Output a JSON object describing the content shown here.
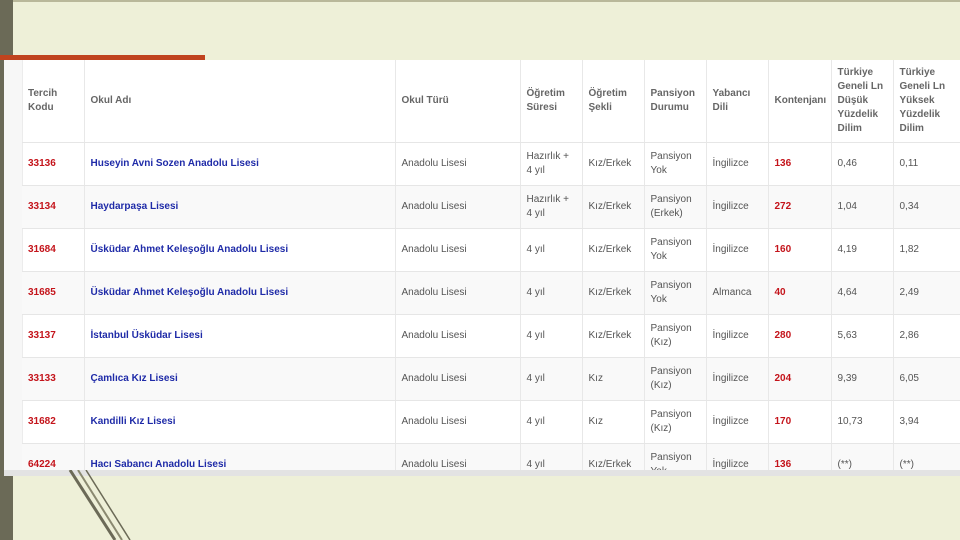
{
  "columns": [
    "Tercih Kodu",
    "Okul Adı",
    "Okul Türü",
    "Öğretim Süresi",
    "Öğretim Şekli",
    "Pansiyon Durumu",
    "Yabancı Dili",
    "Kontenjanı",
    "Türkiye Geneli Ln Düşük Yüzdelik Dilim",
    "Türkiye Geneli Ln Yüksek Yüzdelik Dilim"
  ],
  "rows": [
    {
      "code": "33136",
      "name": "Huseyin Avni Sozen Anadolu Lisesi",
      "type": "Anadolu Lisesi",
      "duration": "Hazırlık + 4 yıl",
      "mode": "Kız/Erkek",
      "boarding": "Pansiyon Yok",
      "language": "İngilizce",
      "quota": "136",
      "low": "0,46",
      "high": "0,11"
    },
    {
      "code": "33134",
      "name": "Haydarpaşa Lisesi",
      "type": "Anadolu Lisesi",
      "duration": "Hazırlık + 4 yıl",
      "mode": "Kız/Erkek",
      "boarding": "Pansiyon (Erkek)",
      "language": "İngilizce",
      "quota": "272",
      "low": "1,04",
      "high": "0,34"
    },
    {
      "code": "31684",
      "name": "Üsküdar Ahmet Keleşoğlu Anadolu Lisesi",
      "type": "Anadolu Lisesi",
      "duration": "4 yıl",
      "mode": "Kız/Erkek",
      "boarding": "Pansiyon Yok",
      "language": "İngilizce",
      "quota": "160",
      "low": "4,19",
      "high": "1,82"
    },
    {
      "code": "31685",
      "name": "Üsküdar Ahmet Keleşoğlu Anadolu Lisesi",
      "type": "Anadolu Lisesi",
      "duration": "4 yıl",
      "mode": "Kız/Erkek",
      "boarding": "Pansiyon Yok",
      "language": "Almanca",
      "quota": "40",
      "low": "4,64",
      "high": "2,49"
    },
    {
      "code": "33137",
      "name": "İstanbul Üsküdar Lisesi",
      "type": "Anadolu Lisesi",
      "duration": "4 yıl",
      "mode": "Kız/Erkek",
      "boarding": "Pansiyon (Kız)",
      "language": "İngilizce",
      "quota": "280",
      "low": "5,63",
      "high": "2,86"
    },
    {
      "code": "33133",
      "name": "Çamlıca Kız Lisesi",
      "type": "Anadolu Lisesi",
      "duration": "4 yıl",
      "mode": "Kız",
      "boarding": "Pansiyon (Kız)",
      "language": "İngilizce",
      "quota": "204",
      "low": "9,39",
      "high": "6,05"
    },
    {
      "code": "31682",
      "name": "Kandilli Kız Lisesi",
      "type": "Anadolu Lisesi",
      "duration": "4 yıl",
      "mode": "Kız",
      "boarding": "Pansiyon (Kız)",
      "language": "İngilizce",
      "quota": "170",
      "low": "10,73",
      "high": "3,94"
    },
    {
      "code": "64224",
      "name": "Hacı Sabancı Anadolu Lisesi",
      "type": "Anadolu Lisesi",
      "duration": "4 yıl",
      "mode": "Kız/Erkek",
      "boarding": "Pansiyon Yok",
      "language": "İngilizce",
      "quota": "136",
      "low": "(**)",
      "high": "(**)"
    }
  ]
}
